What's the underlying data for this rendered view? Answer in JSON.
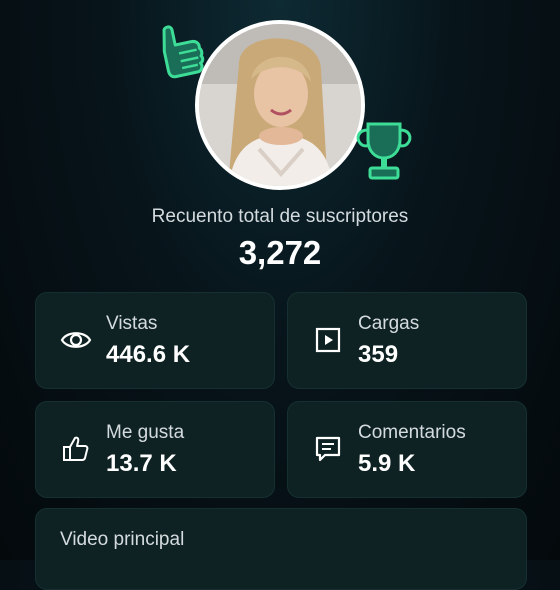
{
  "profile": {
    "subscribers_label": "Recuento total de suscriptores",
    "subscribers_count": "3,272"
  },
  "stats": [
    {
      "label": "Vistas",
      "value": "446.6 K",
      "icon": "eye-icon"
    },
    {
      "label": "Cargas",
      "value": "359",
      "icon": "play-square-icon"
    },
    {
      "label": "Me gusta",
      "value": "13.7 K",
      "icon": "thumbs-up-icon"
    },
    {
      "label": "Comentarios",
      "value": "5.9 K",
      "icon": "comment-icon"
    }
  ],
  "top_video": {
    "label": "Video principal"
  },
  "colors": {
    "accent": "#3ddc97",
    "card_bg": "#0f2223",
    "background": "#07141a"
  }
}
